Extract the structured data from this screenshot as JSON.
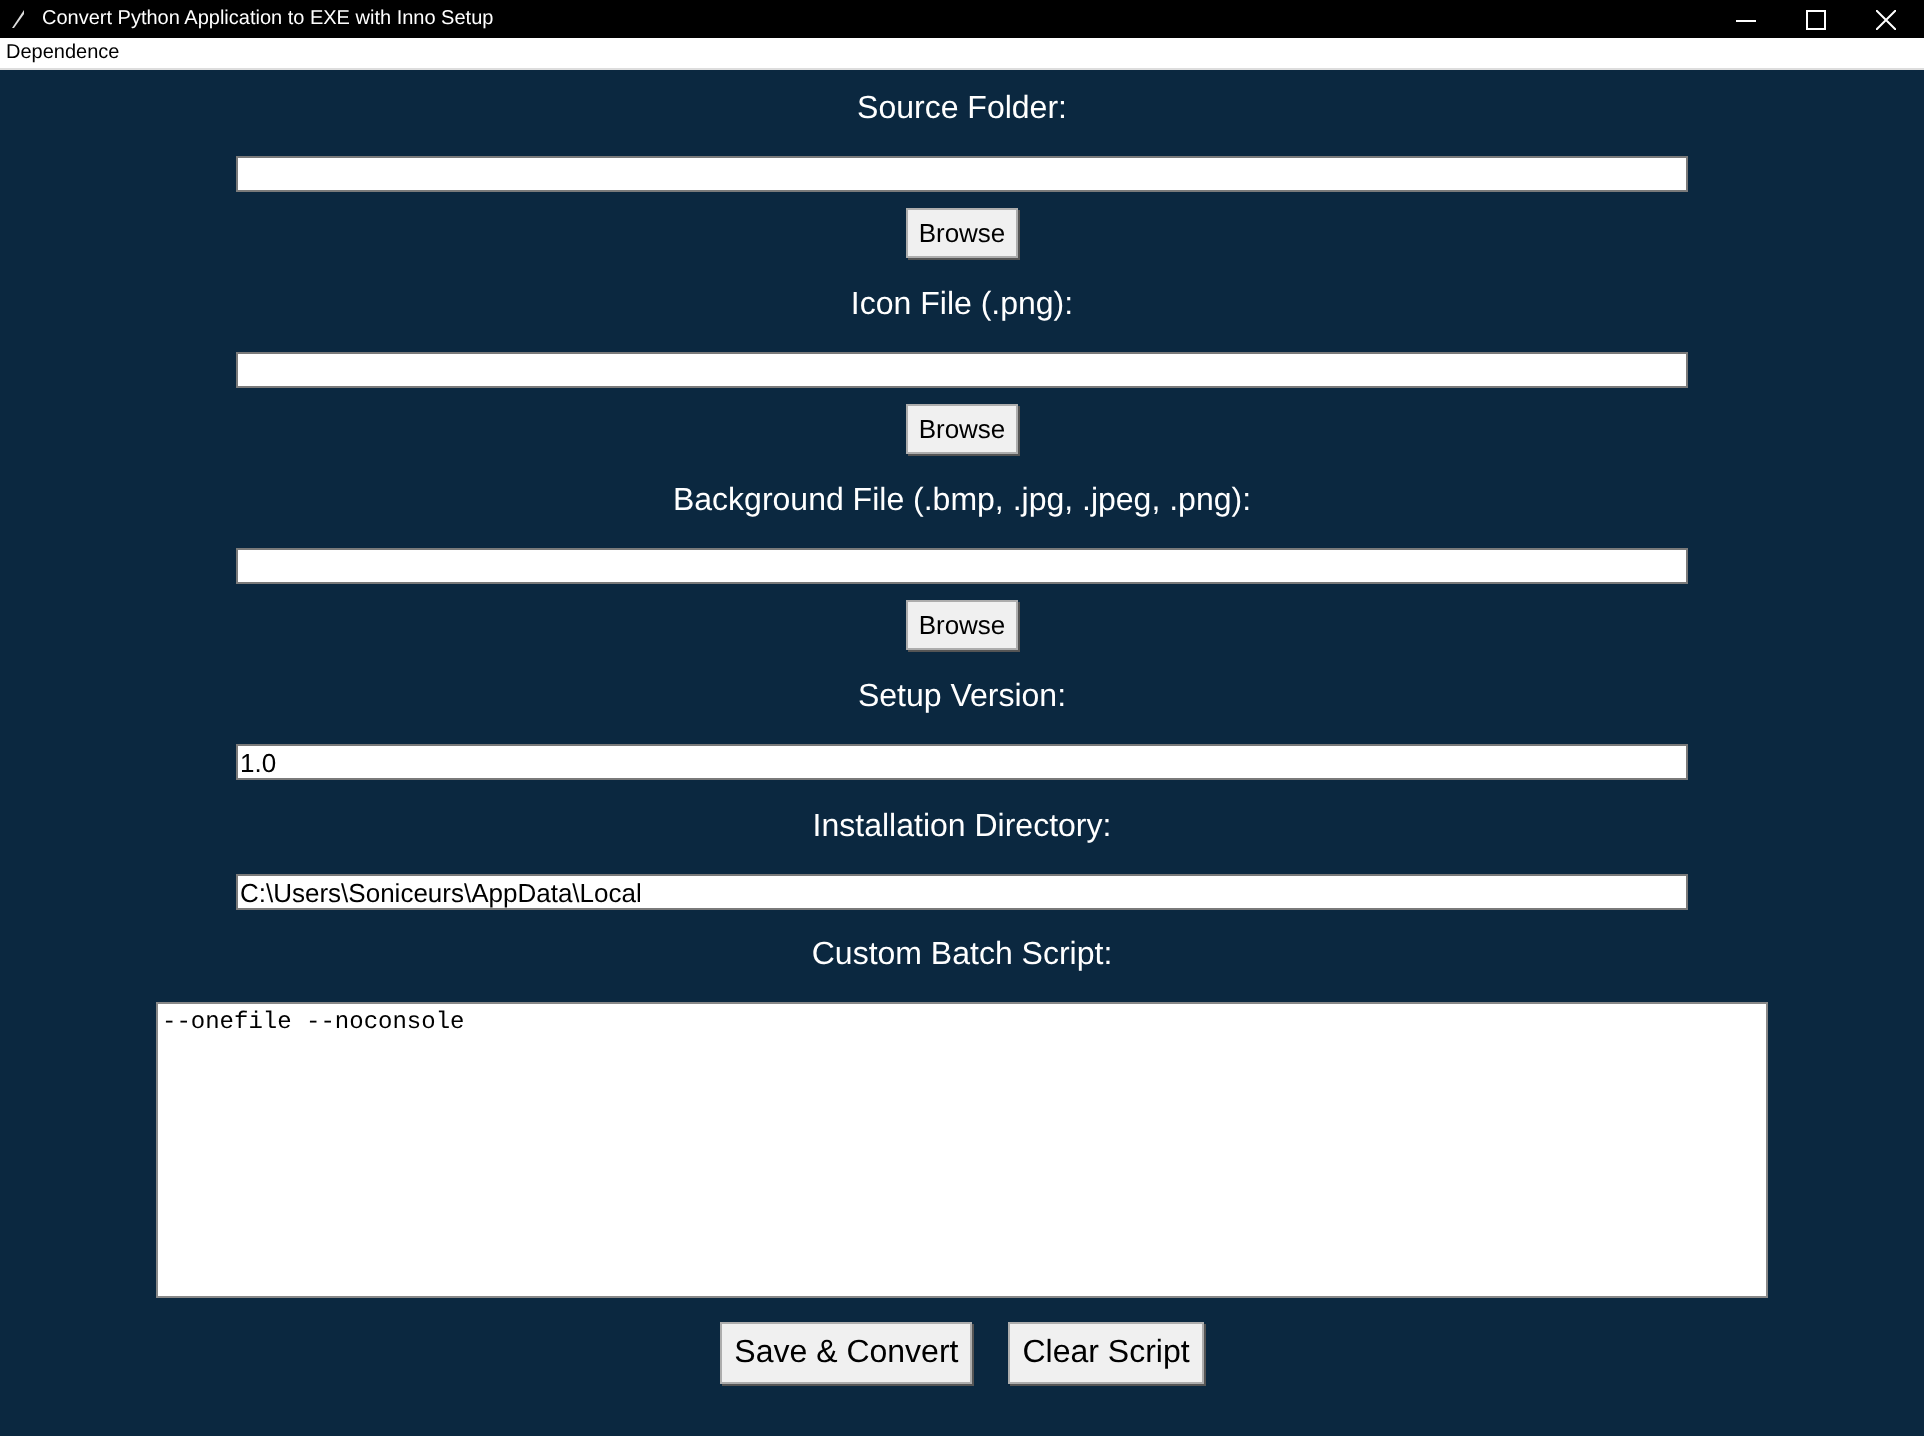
{
  "window": {
    "title": "Convert Python Application to EXE with Inno Setup"
  },
  "menu": [
    "Dependence"
  ],
  "fields": [
    {
      "kind": "file",
      "label": "Source Folder:",
      "button": "Browse"
    },
    {
      "kind": "file",
      "label": "Icon File (.png):",
      "button": "Browse"
    },
    {
      "kind": "file",
      "label": "Background File (.bmp, .jpg, .jpeg, .png):",
      "button": "Browse"
    },
    {
      "kind": "text",
      "label": "Setup Version:",
      "value": "1.0"
    },
    {
      "kind": "text",
      "label": "Installation Directory:",
      "value": "C:\\Users\\Soniceurs\\AppData\\Local"
    }
  ],
  "script": {
    "label": "Custom Batch Script:",
    "value": "--onefile --noconsole"
  },
  "buttons": [
    "Save & Convert",
    "Clear Script"
  ]
}
